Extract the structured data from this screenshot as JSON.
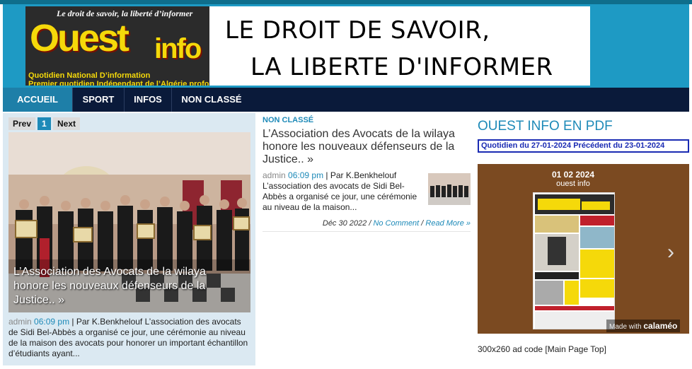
{
  "header": {
    "logo": {
      "tagline": "Le droit de savoir, la liberté d’informer",
      "brand_ouest": "Ouest",
      "brand_info": "info",
      "subtitle_1": "Quotidien National D’information",
      "subtitle_2": "Premier quotidien Indépendant de l’Algérie profonde"
    },
    "banner": {
      "line1": "LE DROIT DE SAVOIR,",
      "line2": "LA LIBERTE D'INFORMER"
    }
  },
  "nav": {
    "items": [
      {
        "label": "ACCUEIL",
        "active": true
      },
      {
        "label": "SPORT",
        "active": false
      },
      {
        "label": "INFOS",
        "active": false
      },
      {
        "label": "NON CLASSÉ",
        "active": false
      }
    ]
  },
  "slider": {
    "prev": "Prev",
    "page": "1",
    "next": "Next",
    "title": "L’Association des Avocats de la wilaya honore les nouveaux défenseurs de la Justice.. »",
    "meta_admin": "admin",
    "meta_time": "06:09 pm",
    "meta_text": " | Par K.Benkhelouf L’association des avocats de Sidi Bel-Abbès a organisé ce jour, une  cérémonie au niveau de la  maison des  avocats pour honorer un  important échantillon d’étudiants ayant..."
  },
  "post": {
    "category": "NON CLASSÉ",
    "title": "L’Association des Avocats de la wilaya honore les nouveaux défenseurs de la Justice.. »",
    "meta_admin": "admin",
    "meta_time": "06:09 pm",
    "meta_text": " | Par K.Benkhelouf L’association des avocats de Sidi Bel-Abbès a organisé ce jour, une  cérémonie au niveau de la  maison...",
    "date": "Déc 30 2022",
    "comment_link": "No Comment",
    "read_more": "Read More »"
  },
  "sidebar": {
    "pdf_title": "OUEST INFO EN PDF",
    "pdf_current": "Quotidien du 27-01-2024",
    "pdf_previous": "Précédent du 23-01-2024",
    "viewer_date": "01 02 2024",
    "viewer_sub": "ouest info",
    "made_with": "Made with",
    "calameo": "calaméo",
    "ad_code": "300x260 ad code [Main Page Top]"
  },
  "colors": {
    "header_blue": "#1e9ac4",
    "nav_bg": "#0a1a3a",
    "nav_active": "#1e7fa8",
    "link_blue": "#1e8ab8",
    "logo_yellow": "#f5d90a"
  }
}
